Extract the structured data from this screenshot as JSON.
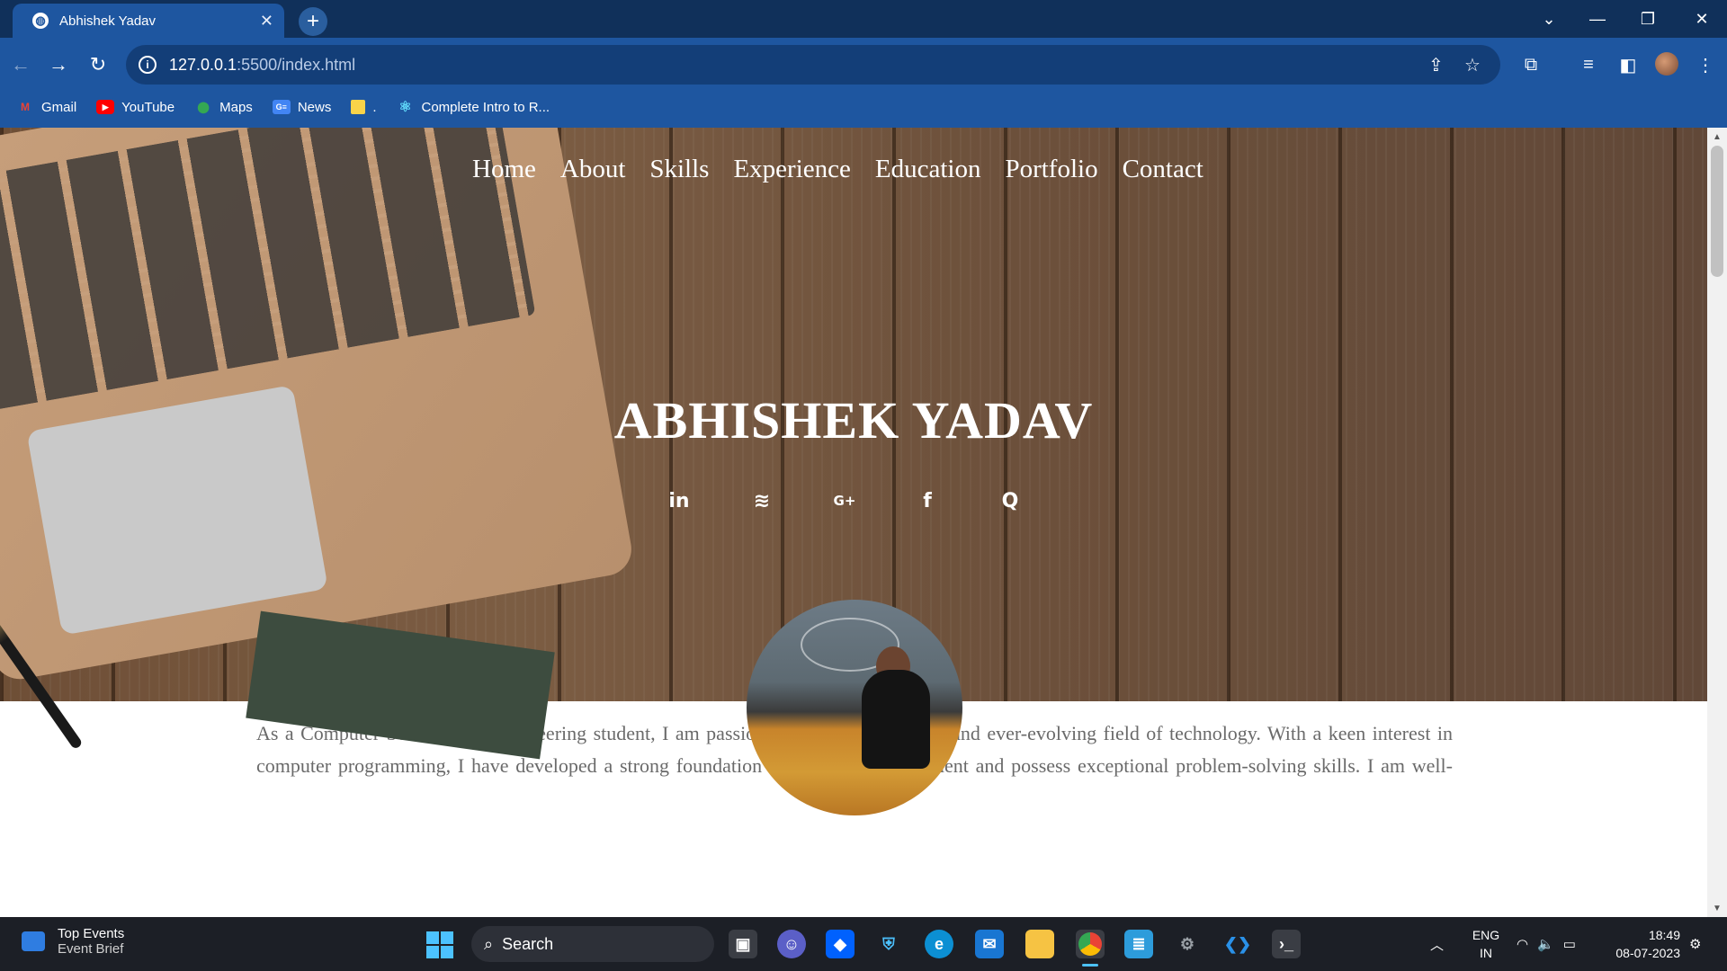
{
  "browser": {
    "tab_title": "Abhishek Yadav",
    "tab_close": "✕",
    "new_tab": "+",
    "url_host": "127.0.0.1",
    "url_path": ":5500/index.html",
    "window_controls": [
      "⌄",
      "—",
      "❐",
      "✕"
    ],
    "bookmarks": [
      {
        "label": "Gmail",
        "icon": "gmail-icon",
        "color": "#ea4335"
      },
      {
        "label": "YouTube",
        "icon": "youtube-icon",
        "color": "#ff0000"
      },
      {
        "label": "Maps",
        "icon": "maps-icon",
        "color": "#34a853"
      },
      {
        "label": "News",
        "icon": "news-icon",
        "color": "#4285f4"
      },
      {
        "label": ".",
        "icon": "folder-icon",
        "color": "#f9d349"
      },
      {
        "label": "Complete Intro to R...",
        "icon": "react-icon",
        "color": "#61dafb"
      }
    ]
  },
  "site": {
    "nav": [
      "Home",
      "About",
      "Skills",
      "Experience",
      "Education",
      "Portfolio",
      "Contact"
    ],
    "hero_title": "ABHISHEK YADAV",
    "socials": [
      {
        "name": "linkedin-icon",
        "glyph": "in"
      },
      {
        "name": "stackoverflow-icon",
        "glyph": "≋"
      },
      {
        "name": "google-plus-icon",
        "glyph": "G+"
      },
      {
        "name": "facebook-icon",
        "glyph": "f"
      },
      {
        "name": "quora-icon",
        "glyph": "Q"
      }
    ],
    "about_text": "As a Computer Science and Engineering student, I am passionate about the dynamic and ever-evolving field of technology. With a keen interest in computer programming, I have developed a strong foundation in software development and possess exceptional problem-solving skills. I am well-"
  },
  "taskbar": {
    "widget_title": "Top Events",
    "widget_subtitle": "Event Brief",
    "search_label": "Search",
    "language_line1": "ENG",
    "language_line2": "IN",
    "time": "18:49",
    "date": "08-07-2023"
  }
}
